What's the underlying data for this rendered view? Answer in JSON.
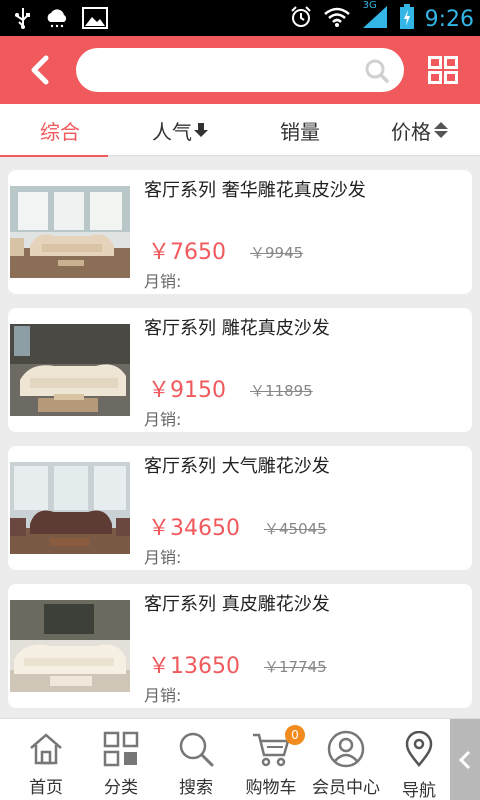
{
  "status_bar": {
    "time": "9:26",
    "network": "3G",
    "icons": [
      "usb-icon",
      "cloud-icon",
      "image-icon",
      "alarm-icon",
      "wifi-icon",
      "signal-icon",
      "battery-icon"
    ]
  },
  "header": {
    "accent": "#f05a5d",
    "search_placeholder": "",
    "icons": [
      "back-arrow-icon",
      "search-icon",
      "grid-icon"
    ]
  },
  "sort_tabs": [
    {
      "label": "综合",
      "active": true
    },
    {
      "label": "人气",
      "icon": "down-arrow-icon"
    },
    {
      "label": "销量"
    },
    {
      "label": "价格",
      "icon": "sort-updown-icon"
    }
  ],
  "products": [
    {
      "name": "客厅系列 奢华雕花真皮沙发",
      "price": "￥7650",
      "old_price": "￥9945",
      "sales_label": "月销:"
    },
    {
      "name": "客厅系列 雕花真皮沙发",
      "price": "￥9150",
      "old_price": "￥11895",
      "sales_label": "月销:"
    },
    {
      "name": "客厅系列 大气雕花沙发",
      "price": "￥34650",
      "old_price": "￥45045",
      "sales_label": "月销:"
    },
    {
      "name": "客厅系列 真皮雕花沙发",
      "price": "￥13650",
      "old_price": "￥17745",
      "sales_label": "月销:"
    }
  ],
  "bottom_nav": [
    {
      "label": "首页",
      "icon": "home-icon"
    },
    {
      "label": "分类",
      "icon": "category-icon"
    },
    {
      "label": "搜索",
      "icon": "search-icon"
    },
    {
      "label": "购物车",
      "icon": "cart-icon",
      "badge": "0"
    },
    {
      "label": "会员中心",
      "icon": "user-icon"
    },
    {
      "label": "导航",
      "icon": "location-icon"
    }
  ]
}
